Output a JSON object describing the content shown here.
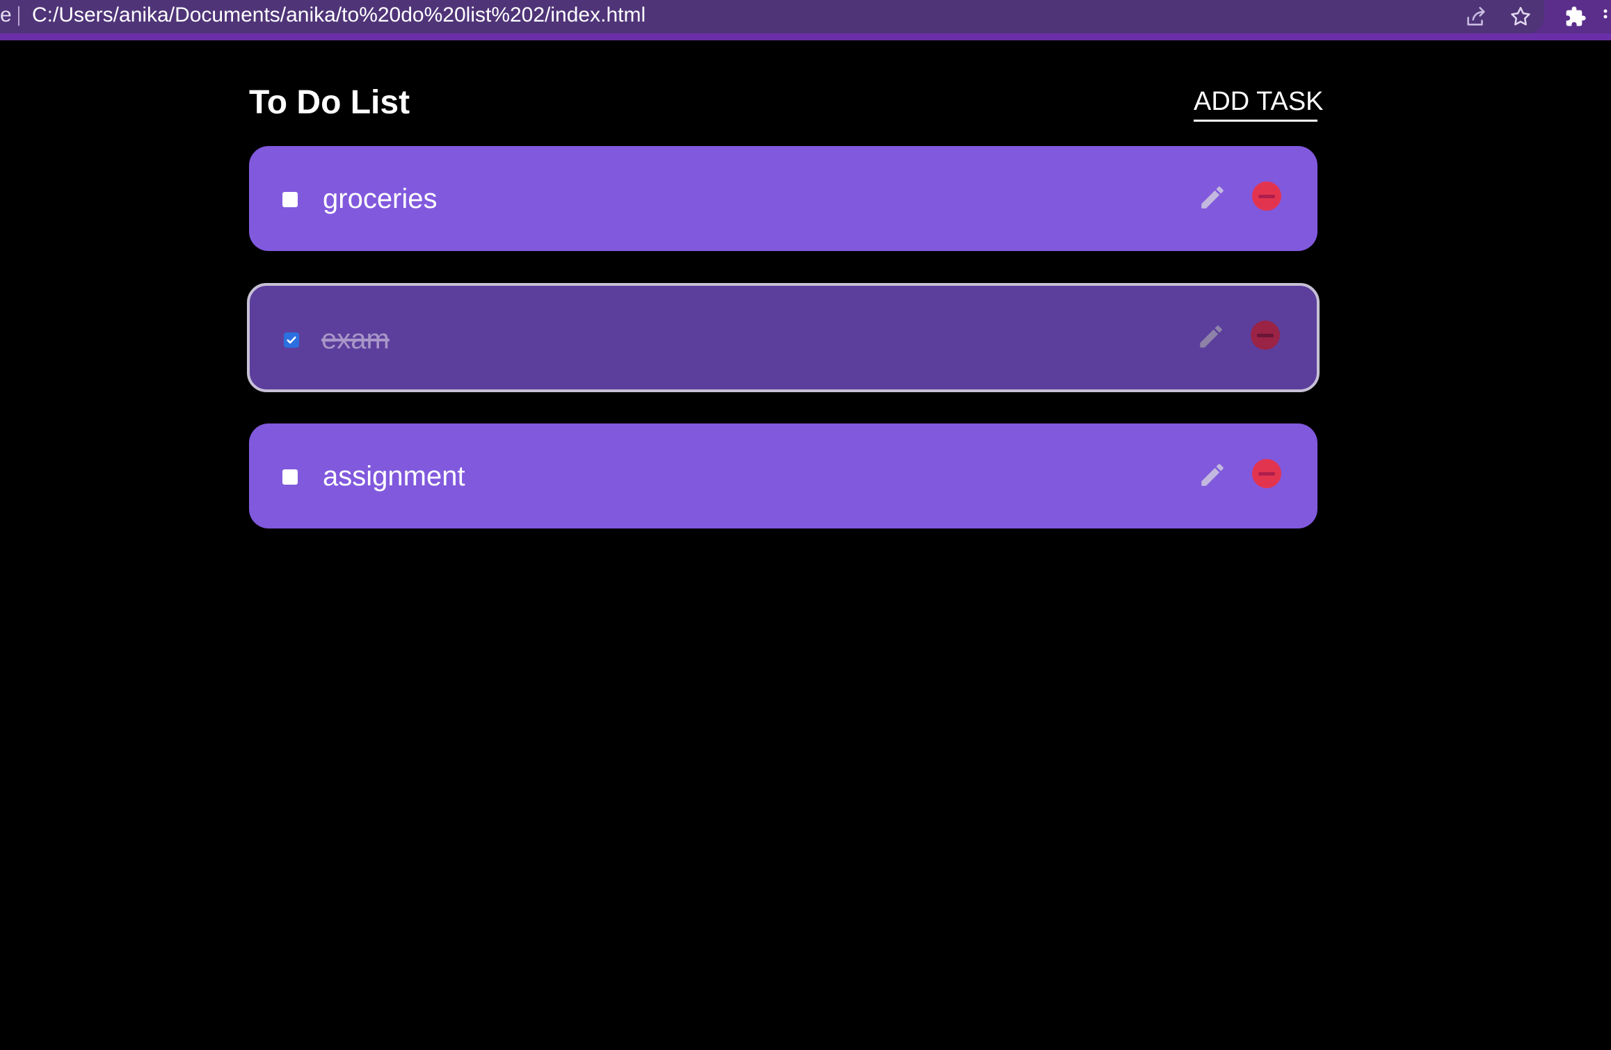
{
  "browser": {
    "url_prefix": "e",
    "url": "C:/Users/anika/Documents/anika/to%20do%20list%202/index.html"
  },
  "app": {
    "title": "To Do List",
    "add_task_label": "ADD TASK"
  },
  "tasks": [
    {
      "label": "groceries",
      "completed": false
    },
    {
      "label": "exam",
      "completed": true
    },
    {
      "label": "assignment",
      "completed": false
    }
  ],
  "colors": {
    "page_background": "#000000",
    "task_background": "#8159dd",
    "task_completed_background": "#5c3f9c",
    "delete_red": "#e3344f",
    "checkbox_checked": "#2c6fe0",
    "browser_chrome": "#4f3478"
  },
  "icons": {
    "share": "share-icon",
    "bookmark": "star-icon",
    "extensions": "puzzle-icon",
    "edit": "pencil-icon",
    "delete": "minus-circle-icon",
    "check": "checkmark-icon"
  }
}
